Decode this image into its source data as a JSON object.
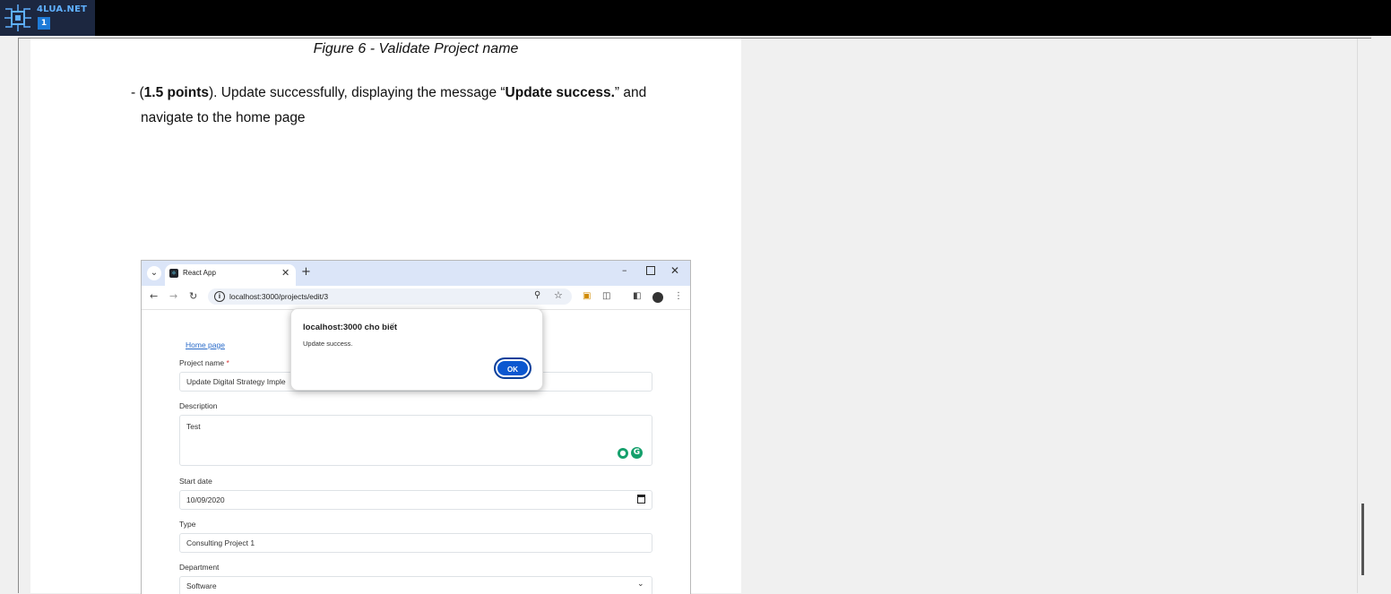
{
  "logo": {
    "text": "4LUA.NET",
    "badge": "1"
  },
  "document": {
    "caption": "Figure 6 - Validate Project name",
    "para_prefix": "- (",
    "para_points": "1.5 points",
    "para_mid": "). Update successfully, displaying the message “",
    "para_msg": "Update success.",
    "para_suffix": "” and",
    "para_line2": "navigate to the home page"
  },
  "browser": {
    "tab_title": "React App",
    "url": "localhost:3000/projects/edit/3"
  },
  "form": {
    "home_link": "Home page",
    "project_name_label": "Project name",
    "required_mark": "*",
    "project_name_value": "Update Digital Strategy Imple",
    "description_label": "Description",
    "description_value": "Test",
    "start_date_label": "Start date",
    "start_date_value": "10/09/2020",
    "type_label": "Type",
    "type_value": "Consulting Project 1",
    "department_label": "Department",
    "department_value": "Software"
  },
  "dialog": {
    "title": "localhost:3000 cho biết",
    "message": "Update success.",
    "ok_label": "OK"
  },
  "colors": {
    "accent": "#0b57d0",
    "tabbar": "#dbe5f8",
    "link": "#2a6bc9"
  }
}
